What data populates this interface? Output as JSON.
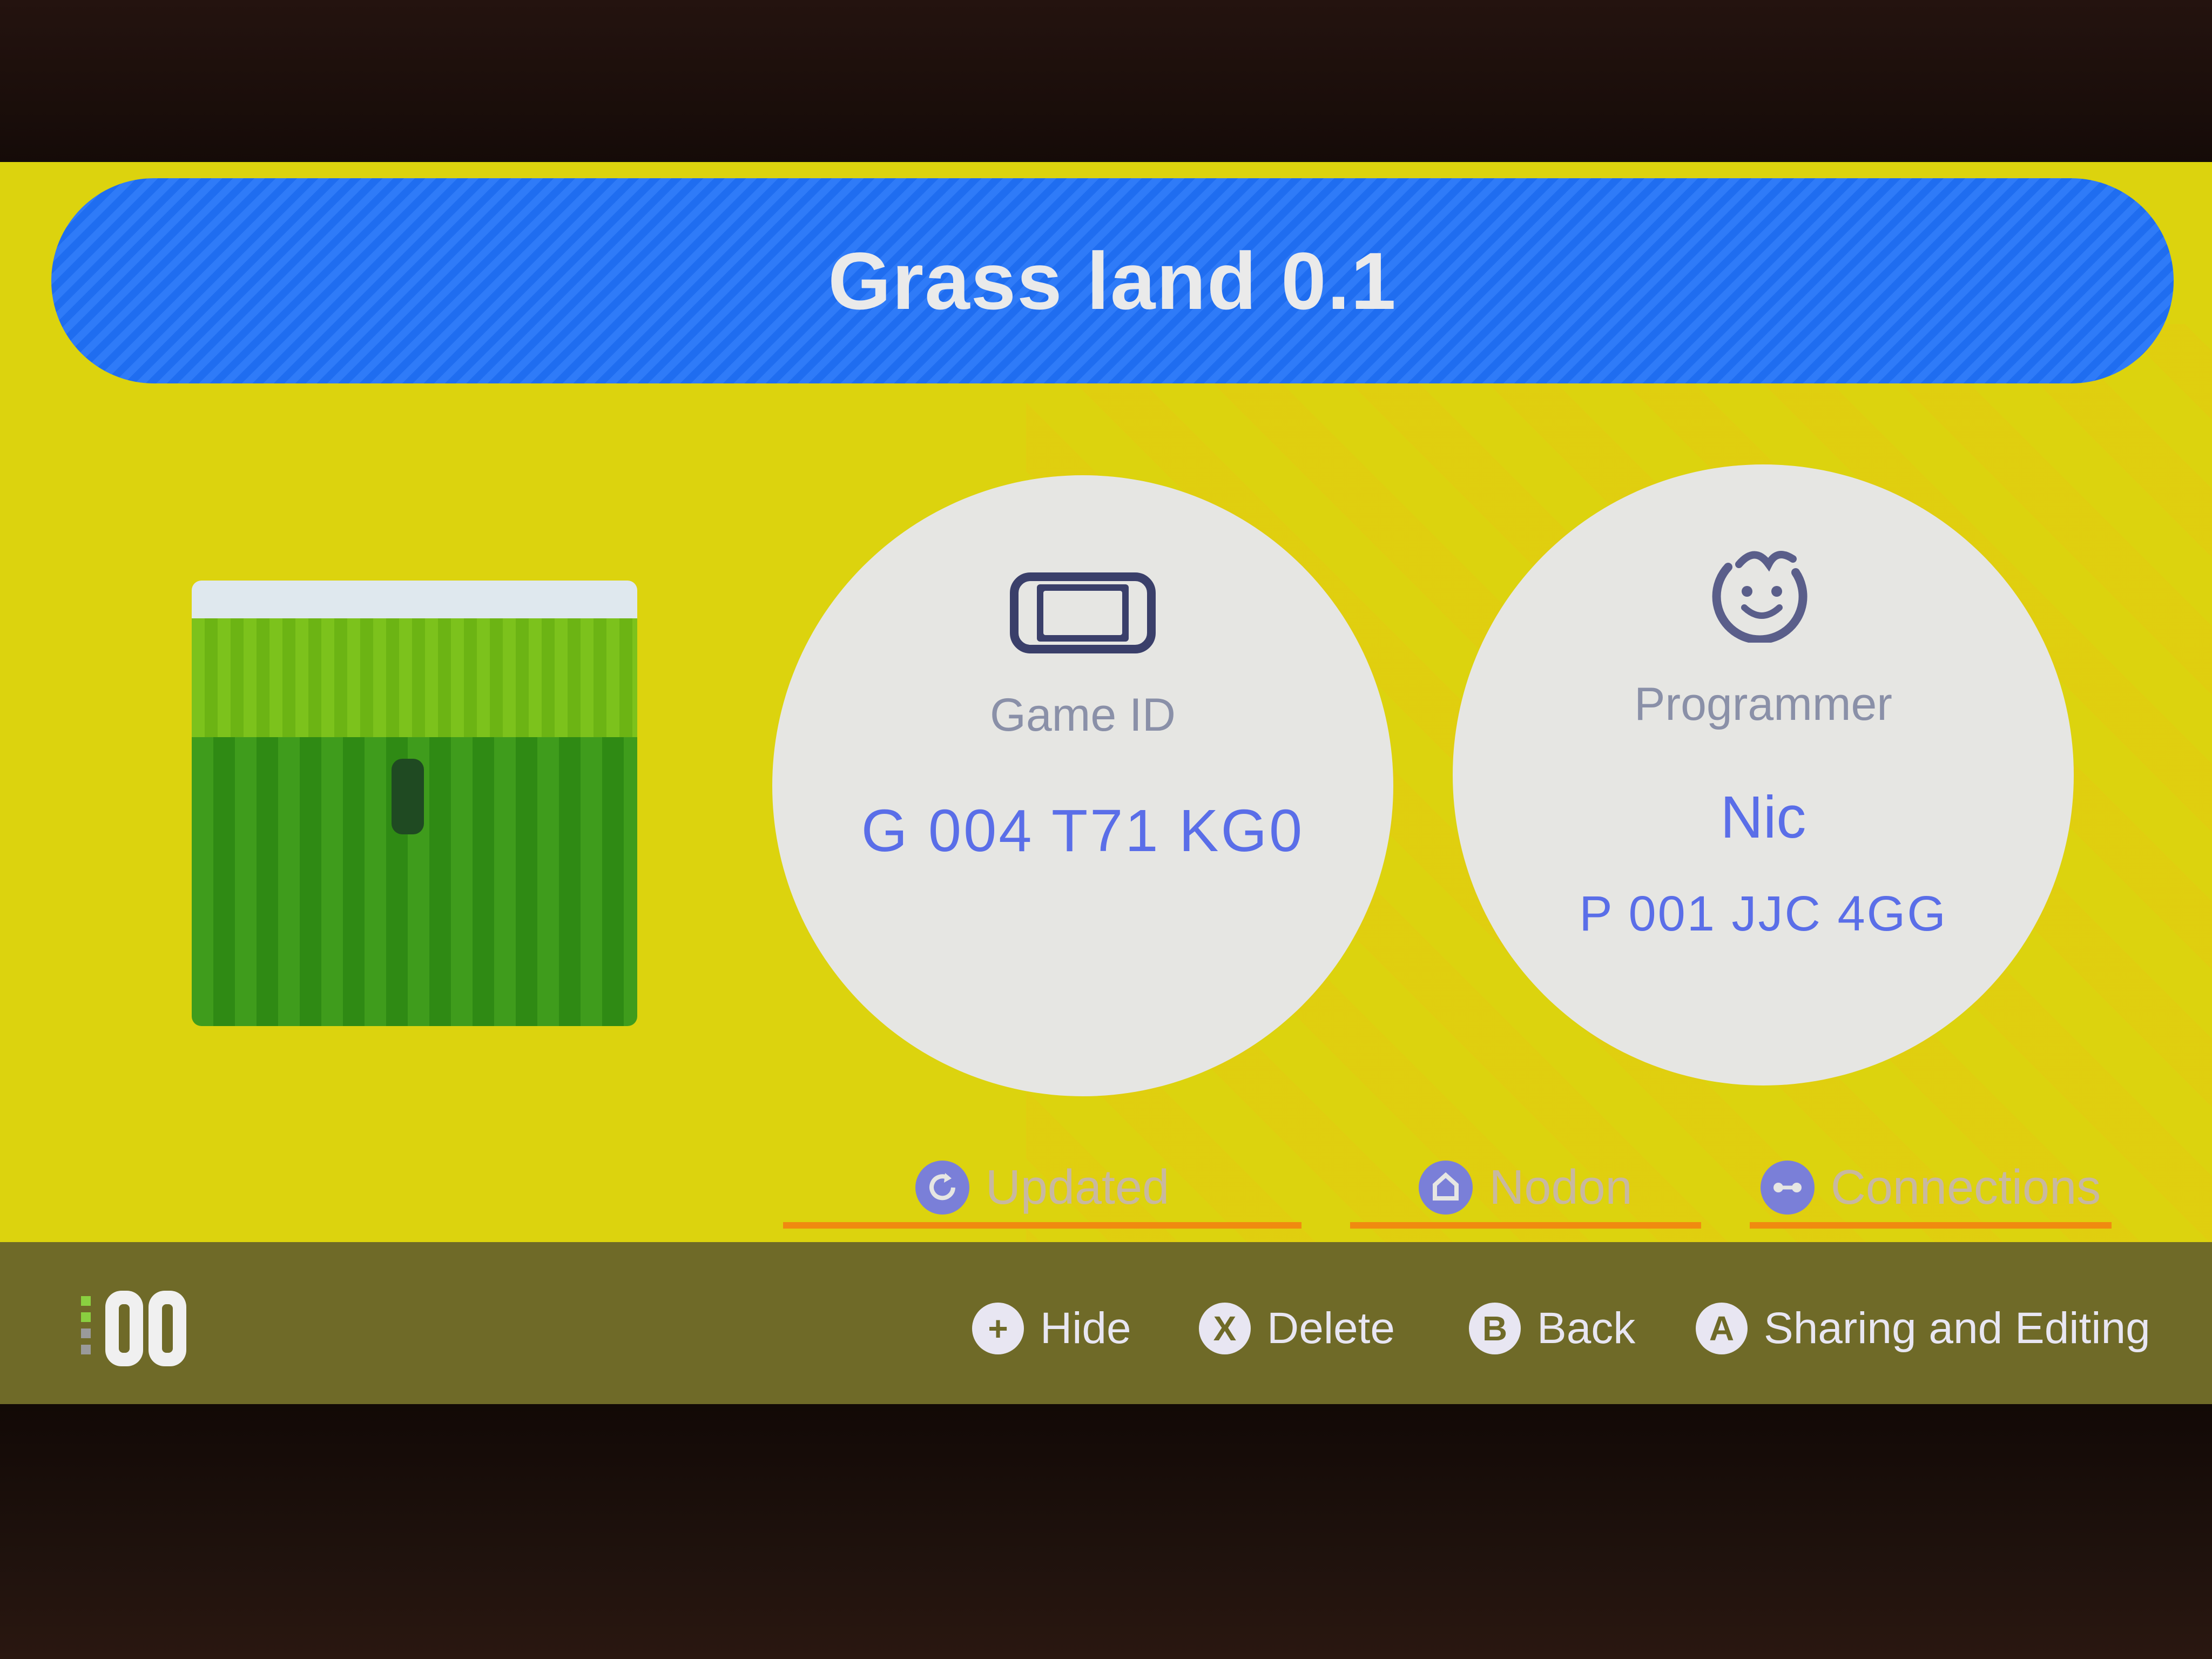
{
  "title": "Grass land 0.1",
  "game_info": {
    "label": "Game ID",
    "value": "G 004 T71 KG0"
  },
  "programmer_info": {
    "label": "Programmer",
    "name": "Nic",
    "id": "P 001 JJC 4GG"
  },
  "tabs": [
    {
      "label": "Updated",
      "icon": "refresh-icon"
    },
    {
      "label": "Nodon",
      "icon": "nodon-icon"
    },
    {
      "label": "Connections",
      "icon": "connections-icon"
    }
  ],
  "footer": {
    "hints": [
      {
        "button": "+",
        "label": "Hide"
      },
      {
        "button": "X",
        "label": "Delete"
      },
      {
        "button": "B",
        "label": "Back"
      },
      {
        "button": "A",
        "label": "Sharing and Editing"
      }
    ]
  },
  "colors": {
    "background": "#dcd30e",
    "title_bar": "#1f6df0",
    "accent_text": "#5a6ee8",
    "tab_underline": "#f08a10",
    "footer": "#6f6a28"
  }
}
